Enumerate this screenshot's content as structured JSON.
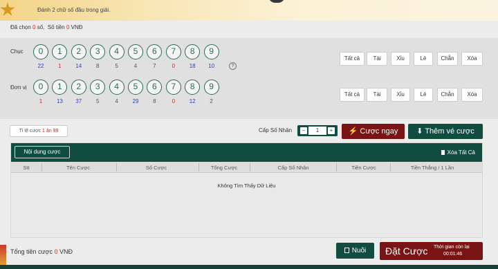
{
  "banner": {
    "hint": "Đánh 2 chữ số đầu trong giải."
  },
  "summary": {
    "selected_prefix": "Đã chọn ",
    "selected_count": "0",
    "selected_suffix": " số,",
    "amount_prefix": "Số tiền ",
    "amount_value": "0",
    "currency": " VNĐ"
  },
  "picker": {
    "tens": {
      "label": "Chục",
      "digits": [
        "0",
        "1",
        "2",
        "3",
        "4",
        "5",
        "6",
        "7",
        "8",
        "9"
      ],
      "frequencies": [
        "22",
        "1",
        "14",
        "8",
        "5",
        "4",
        "7",
        "0",
        "18",
        "10"
      ],
      "freq_colors": [
        "blue",
        "red",
        "blue",
        "gray",
        "gray",
        "gray",
        "gray",
        "red",
        "blue",
        "blue"
      ]
    },
    "units": {
      "label": "Đơn vị",
      "digits": [
        "0",
        "1",
        "2",
        "3",
        "4",
        "5",
        "6",
        "7",
        "8",
        "9"
      ],
      "frequencies": [
        "1",
        "13",
        "37",
        "5",
        "4",
        "29",
        "8",
        "0",
        "12",
        "2"
      ],
      "freq_colors": [
        "red",
        "blue",
        "blue",
        "gray",
        "gray",
        "blue",
        "gray",
        "red",
        "blue",
        "gray"
      ]
    },
    "help_symbol": "?",
    "quick_buttons": [
      "Tất cả",
      "Tài",
      "Xỉu",
      "Lẻ",
      "Chẵn",
      "Xóa"
    ]
  },
  "controls": {
    "ratio_prefix": "Tỉ lệ cược ",
    "ratio_value": "1 ăn 99",
    "multiplier_label": "Cấp Số Nhân",
    "minus": "−",
    "multiplier_value": "1",
    "plus": "+",
    "quick_bet": "Cược ngay",
    "add_to_slip": "Thêm vé cược"
  },
  "bet_panel": {
    "tab_label": "Nội dung cược",
    "clear_all": "Xóa Tất Cả",
    "columns": [
      "Stt",
      "Tên Cược",
      "Số Cược",
      "Tổng Cược",
      "Cấp Số Nhân",
      "Tiền Cược",
      "Tiền Thắng / 1 Lần"
    ],
    "empty_message": "Không Tìm Thấy Dữ Liệu"
  },
  "footer": {
    "total_label": "Tổng tiền cược ",
    "total_value": "0",
    "total_currency": " VNĐ",
    "nuoi_label": "Nuôi",
    "place_bet_label": "Đặt Cược",
    "time_left_label": "Thời gian còn lại",
    "time_left_value": "00:01:46"
  },
  "colors": {
    "primary_green": "#104d40",
    "accent_red": "#7a1414",
    "frequency_blue": "#3340b8",
    "frequency_red": "#dd2222"
  }
}
